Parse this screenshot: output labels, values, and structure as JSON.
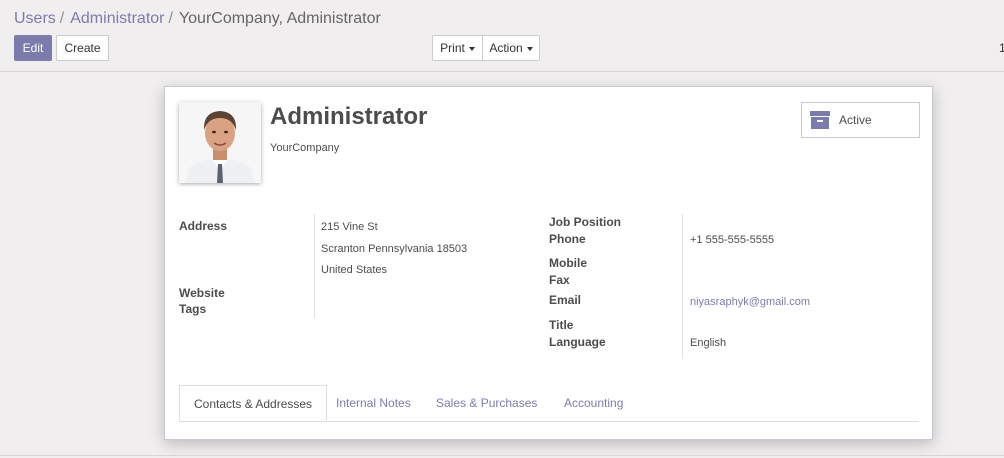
{
  "breadcrumb": {
    "items": [
      "Users",
      "Administrator"
    ],
    "separator": "/",
    "current": "YourCompany, Administrator"
  },
  "toolbar": {
    "edit_label": "Edit",
    "create_label": "Create",
    "print_label": "Print",
    "action_label": "Action",
    "pager_text": "1"
  },
  "partner": {
    "name": "Administrator",
    "company": "YourCompany",
    "status_label": "Active"
  },
  "left_fields": {
    "address_label": "Address",
    "street": "215 Vine St",
    "city_line": "Scranton Pennsylvania 18503",
    "country": "United States",
    "website_label": "Website",
    "tags_label": "Tags"
  },
  "right_fields": {
    "job_position_label": "Job Position",
    "phone_label": "Phone",
    "phone_value": "+1 555-555-5555",
    "mobile_label": "Mobile",
    "fax_label": "Fax",
    "email_label": "Email",
    "email_value": "niyasraphyk@gmail.com",
    "title_label": "Title",
    "language_label": "Language",
    "language_value": "English"
  },
  "tabs": [
    "Contacts & Addresses",
    "Internal Notes",
    "Sales & Purchases",
    "Accounting"
  ],
  "colors": {
    "brand": "#7c7bad",
    "background": "#f0eeee"
  }
}
